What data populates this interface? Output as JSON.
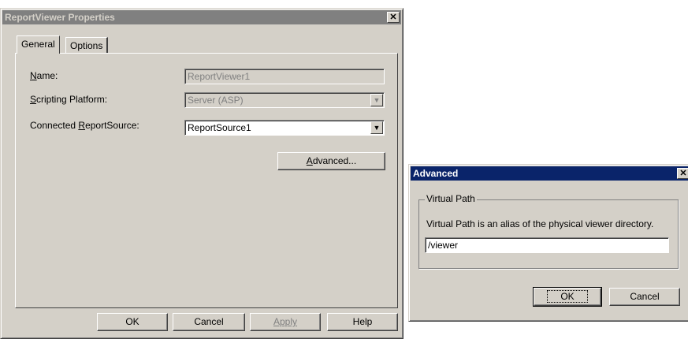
{
  "props_window": {
    "title": "ReportViewer Properties",
    "tabs": [
      "General",
      "Options"
    ],
    "name_label_pre": "",
    "name_label_u": "N",
    "name_label_post": "ame:",
    "name_value": "ReportViewer1",
    "scripting_label_u": "S",
    "scripting_label_post": "cripting Platform:",
    "scripting_value": "Server (ASP)",
    "connected_label_pre": "Connected ",
    "connected_label_u": "R",
    "connected_label_post": "eportSource:",
    "connected_value": "ReportSource1",
    "advanced_button_u": "A",
    "advanced_button_post": "dvanced...",
    "ok_label": "OK",
    "cancel_label": "Cancel",
    "apply_label": "Apply",
    "help_label": "Help"
  },
  "advanced_window": {
    "title": "Advanced",
    "group_label": "Virtual Path",
    "description": "Virtual Path is an alias of the physical viewer directory.",
    "path_value": "/viewer",
    "ok_label": "OK",
    "cancel_label": "Cancel"
  },
  "icons": {
    "close": "close-icon",
    "dropdown": "chevron-down-icon"
  }
}
